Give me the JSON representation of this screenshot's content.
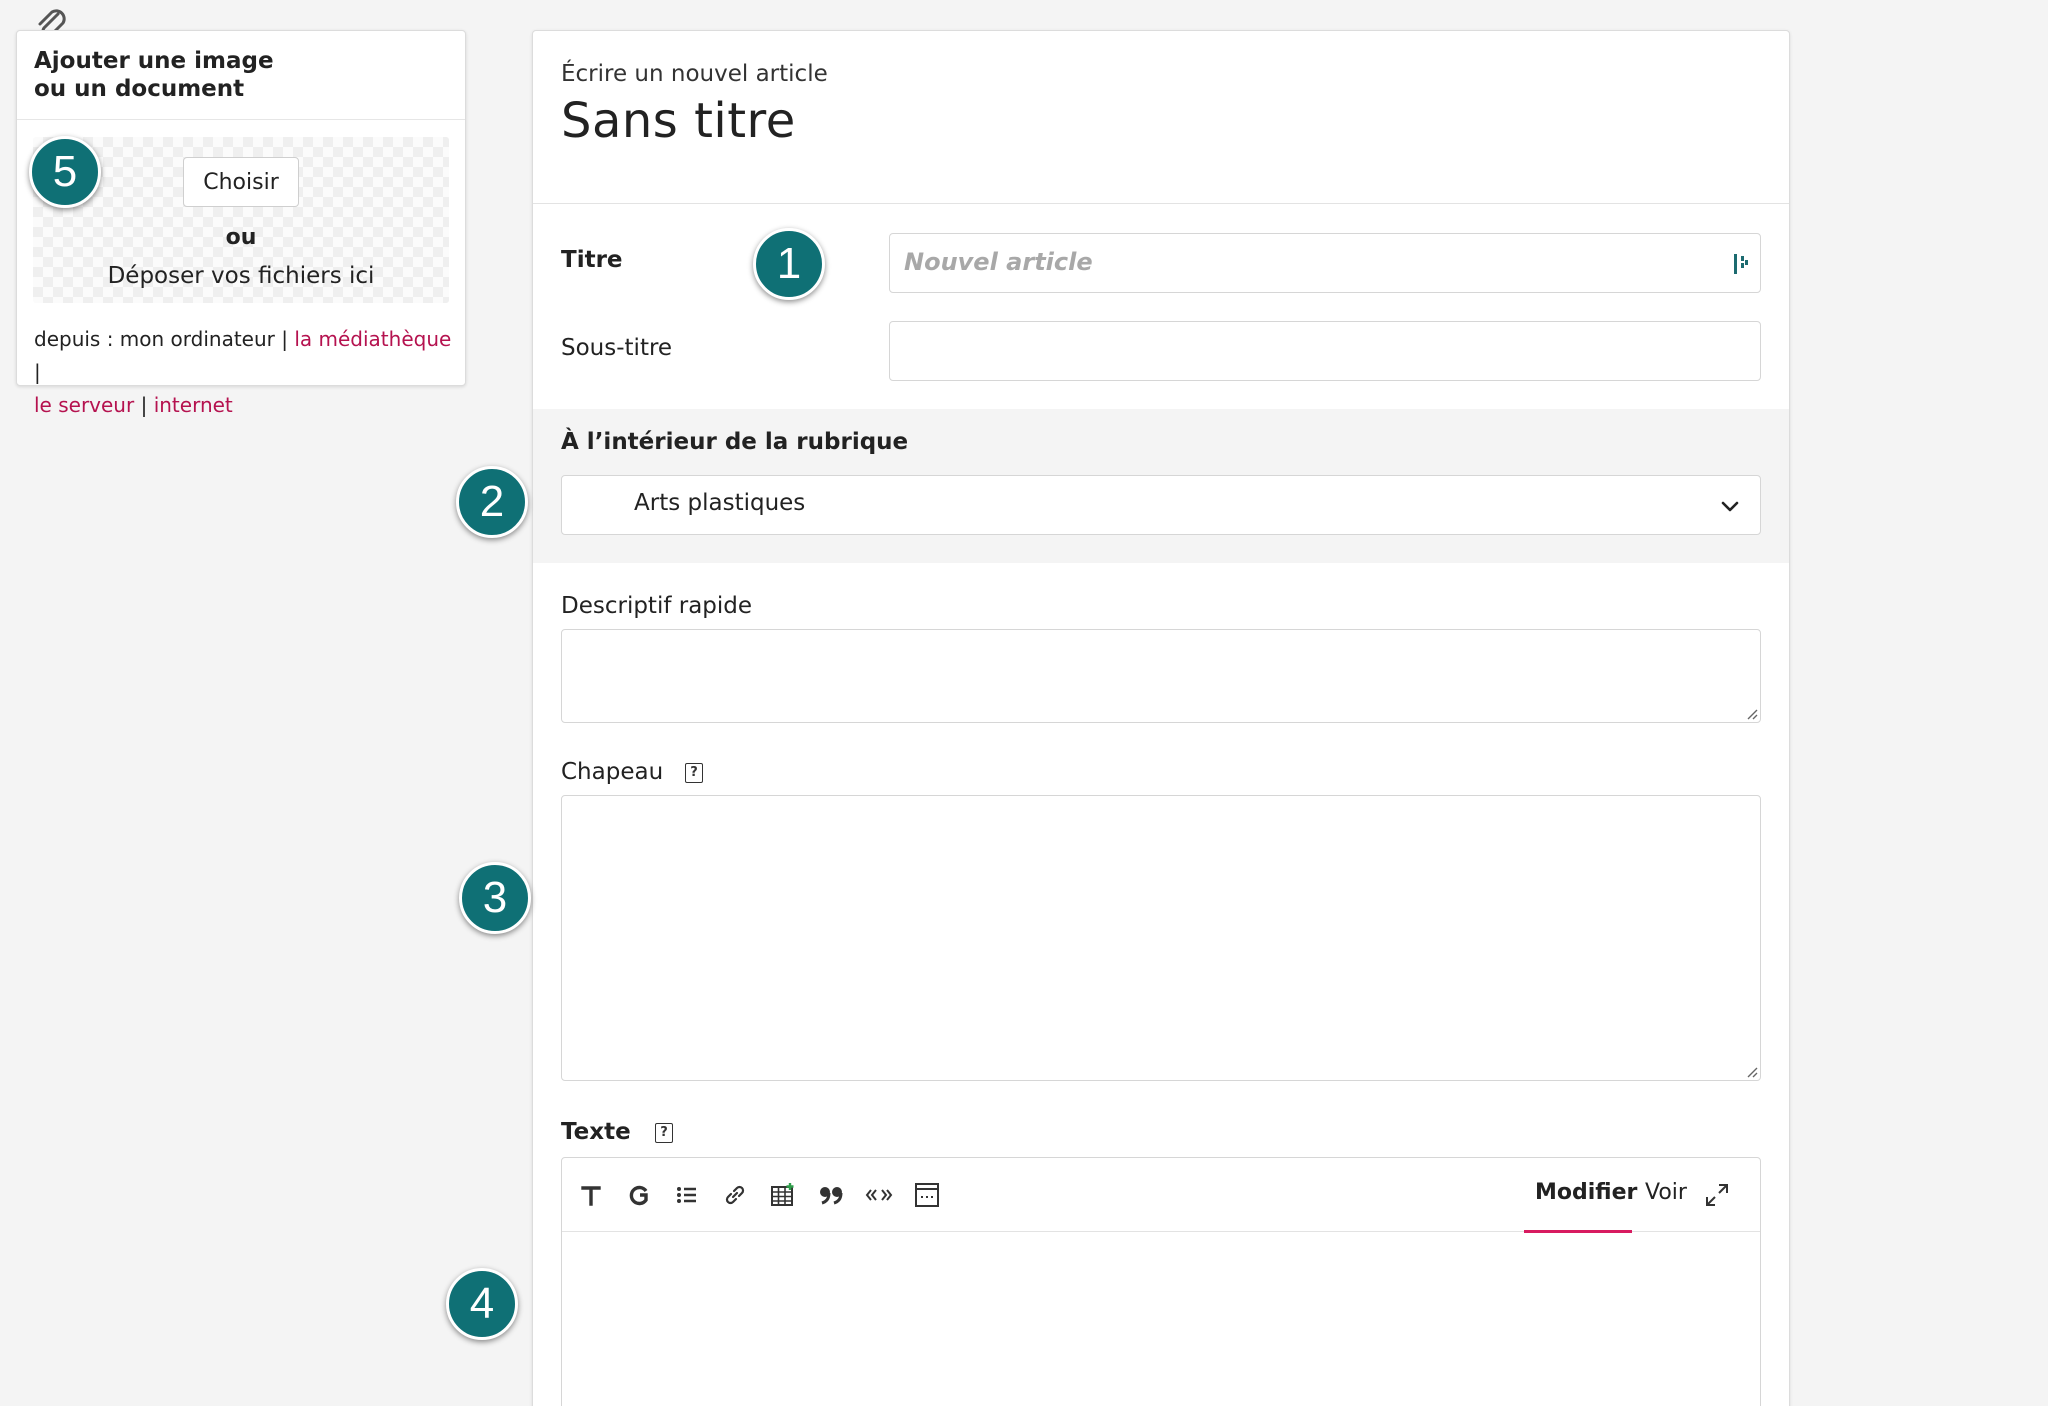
{
  "upload": {
    "title_line1": "Ajouter une image",
    "title_line2": "ou un document",
    "choose_label": "Choisir",
    "or_label": "ou",
    "drop_label": "Déposer vos fichiers ici",
    "sources_prefix": "depuis : mon ordinateur |",
    "sources_sep": "|",
    "source_mediatheque": "la médiathèque",
    "source_serveur": "le serveur",
    "source_internet": "internet"
  },
  "header": {
    "subhead": "Écrire un nouvel article",
    "title": "Sans titre"
  },
  "form": {
    "titre_label": "Titre",
    "titre_placeholder": "Nouvel article",
    "soustitre_label": "Sous-titre",
    "rubrique_label": "À l’intérieur de la rubrique",
    "rubrique_value": "Arts plastiques",
    "descriptif_label": "Descriptif rapide",
    "chapeau_label": "Chapeau",
    "texte_label": "Texte",
    "help_glyph": "?"
  },
  "editor": {
    "tab_modifier": "Modifier",
    "tab_voir": "Voir",
    "tools": [
      "heading-icon",
      "bold-icon",
      "list-icon",
      "link-icon",
      "table-icon",
      "quote-icon",
      "code-icon",
      "image-block-icon",
      "expand-icon"
    ]
  },
  "badges": [
    "1",
    "2",
    "3",
    "4",
    "5"
  ],
  "colors": {
    "badge": "#0f7075",
    "link": "#b5124f",
    "active_tab_underline": "#d81b60"
  }
}
